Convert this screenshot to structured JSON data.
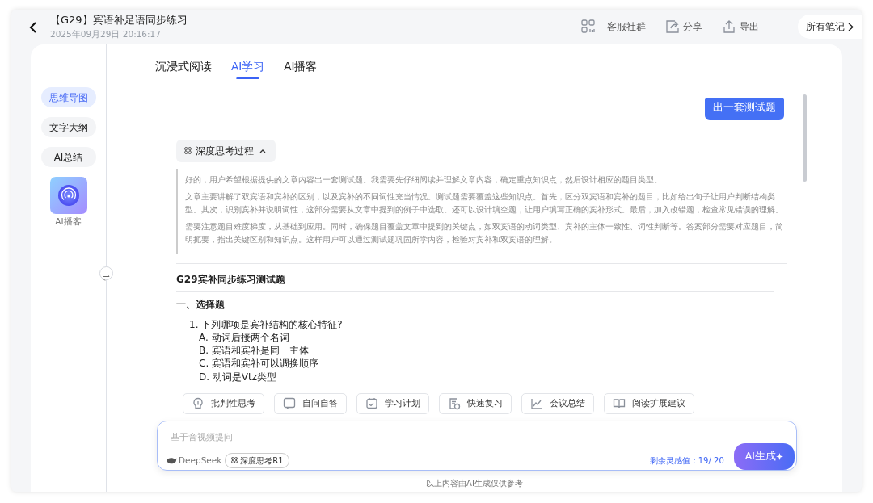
{
  "header": {
    "title": "【G29】宾语补足语同步练习",
    "date": "2025年09月29日 20:16:17",
    "actions": [
      {
        "label": "客服社群"
      },
      {
        "label": "分享"
      },
      {
        "label": "导出"
      }
    ],
    "all_notes": "所有笔记"
  },
  "sidebar": {
    "items": [
      {
        "label": "思维导图",
        "selected": true
      },
      {
        "label": "文字大纲",
        "selected": false
      },
      {
        "label": "AI总结",
        "selected": false
      }
    ],
    "podcast": {
      "label": "AI播客"
    }
  },
  "tabs": [
    {
      "label": "沉浸式阅读",
      "selected": false
    },
    {
      "label": "AI学习",
      "selected": true
    },
    {
      "label": "AI播客",
      "selected": false
    }
  ],
  "chat": {
    "user_message": "出一套测试题",
    "thinking": {
      "label": "深度思考过程",
      "expanded": true,
      "paragraphs": [
        "好的，用户希望根据提供的文章内容出一套测试题。我需要先仔细阅读并理解文章内容，确定重点知识点，然后设计相应的题目类型。",
        "文章主要讲解了双宾语和宾补的区别，以及宾补的不同词性充当情况。测试题需要覆盖这些知识点。首先，区分双宾语和宾补的题目，比如给出句子让用户判断结构类型。其次，识别宾补并说明词性，这部分需要从文章中提到的例子中选取。还可以设计填空题，让用户填写正确的宾补形式。最后，加入改错题，检查常见错误的理解。",
        "需要注意题目难度梯度，从基础到应用。同时，确保题目覆盖文章中提到的关键点，如双宾语的动词类型、宾补的主体一致性、词性判断等。答案部分需要对应题目，简明扼要，指出关键区别和知识点。这样用户可以通过测试题巩固所学内容，检验对宾补和双宾语的理解。"
      ]
    },
    "answer": {
      "title": "G29宾补同步练习测试题",
      "section": "一、选择题",
      "questions": [
        {
          "text": "1. 下列哪项是宾补结构的核心特征?",
          "options": [
            "A. 动词后接两个名词",
            "B. 宾语和宾补是同一主体",
            "C. 宾语和宾补可以调换顺序",
            "D. 动词是Vtz类型"
          ]
        }
      ]
    }
  },
  "chips": [
    {
      "label": "批判性思考"
    },
    {
      "label": "自问自答"
    },
    {
      "label": "学习计划"
    },
    {
      "label": "快速复习"
    },
    {
      "label": "会议总结"
    },
    {
      "label": "阅读扩展建议"
    }
  ],
  "input": {
    "placeholder": "基于音视频提问",
    "model": "DeepSeek",
    "deep_think": {
      "label": "深度思考R1",
      "on": true
    },
    "quota": "剩余灵感值：19/ 20",
    "generate": "AI生成"
  },
  "footer_note": "以上内容由AI生成仅供参考"
}
